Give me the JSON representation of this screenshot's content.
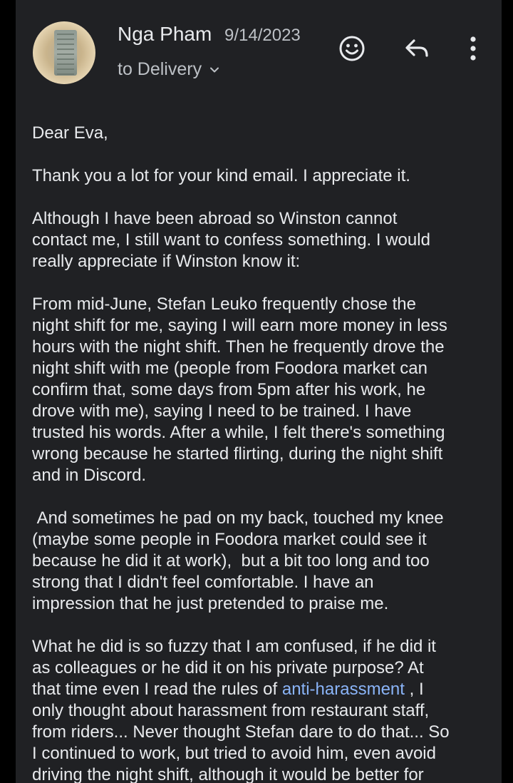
{
  "header": {
    "sender_name": "Nga Pham",
    "date": "9/14/2023",
    "recipient_label": "to Delivery",
    "actions": [
      "emoji-reaction",
      "reply",
      "more-options"
    ]
  },
  "icons": {
    "avatar": "avatar-photo",
    "recipient_toggle": "chevron-down-icon",
    "emoji": "smiley-icon",
    "reply": "reply-arrow-icon",
    "more": "more-vertical-icon"
  },
  "colors": {
    "background": "#202124",
    "text": "#e8eaed",
    "secondary_text": "#bdc1c6",
    "link": "#8ab4f8"
  },
  "message": {
    "greeting": "Dear Eva,",
    "p1": "Thank you a lot for your kind email. I appreciate it.",
    "p2": "Although I have been abroad so Winston cannot\ncontact me, I still want to confess something. I would\nreally appreciate if Winston know it:",
    "p3": "From mid-June, Stefan Leuko frequently chose the\nnight shift for me, saying I will earn more money in less\nhours with the night shift. Then he frequently drove the\nnight shift with me (people from Foodora market can\nconfirm that, some days from 5pm after his work, he\ndrove with me), saying I need to be trained. I have\ntrusted his words. After a while, I felt there's something\nwrong because he started flirting, during the night shift\nand in Discord.",
    "p4": " And sometimes he pad on my back, touched my knee\n(maybe some people in Foodora market could see it\nbecause he did it at work),  but a bit too long and too\nstrong that I didn't feel comfortable. I have an\nimpression that he just pretended to praise me.",
    "p5_before_link": "What he did is so fuzzy that I am confused, if he did it\nas colleagues or he did it on his private purpose? At\nthat time even I read the rules of ",
    "p5_link": "anti-harassment",
    "p5_after_link": " , I\nonly thought about harassment from restaurant staff,\nfrom riders... Never thought Stefan dare to do that... So\nI continued to work, but tried to avoid him, even avoid\ndriving the night shift, although it would be better for"
  }
}
